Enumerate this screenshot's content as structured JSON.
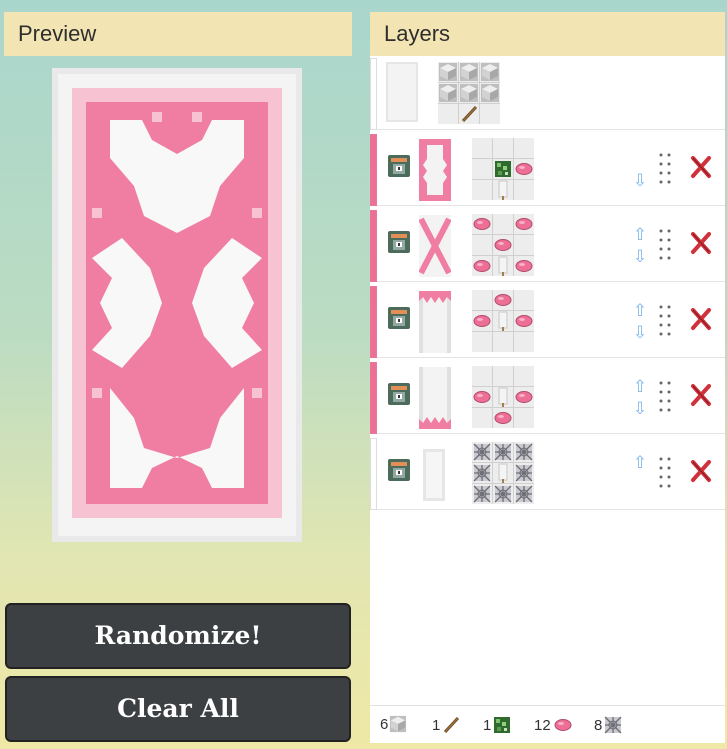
{
  "preview": {
    "title": "Preview"
  },
  "layers": {
    "title": "Layers",
    "base": {
      "color": "#ffffff"
    },
    "rows": [
      {
        "accent": "#ee6f96",
        "pattern": "bordure-indented",
        "up": false,
        "down": true
      },
      {
        "accent": "#ee6f96",
        "pattern": "saltire",
        "up": true,
        "down": true
      },
      {
        "accent": "#ee6f96",
        "pattern": "chief-indented",
        "up": true,
        "down": true
      },
      {
        "accent": "#ee6f96",
        "pattern": "base-indented",
        "up": true,
        "down": true
      },
      {
        "accent": "#ffffff",
        "pattern": "border",
        "up": true,
        "down": false
      }
    ]
  },
  "buttons": {
    "randomize": "Randomize!",
    "clear": "Clear All"
  },
  "totals": [
    {
      "count": "6",
      "item": "white-wool"
    },
    {
      "count": "1",
      "item": "stick"
    },
    {
      "count": "1",
      "item": "vines"
    },
    {
      "count": "12",
      "item": "pink-dye"
    },
    {
      "count": "8",
      "item": "cobweb"
    }
  ],
  "colors": {
    "pink": "#ee6f96",
    "banner_white": "#f2f2f2",
    "header": "#f3e5b3",
    "button": "#3d4042",
    "arrow": "#7fb6ea",
    "delete": "#d0313a"
  }
}
